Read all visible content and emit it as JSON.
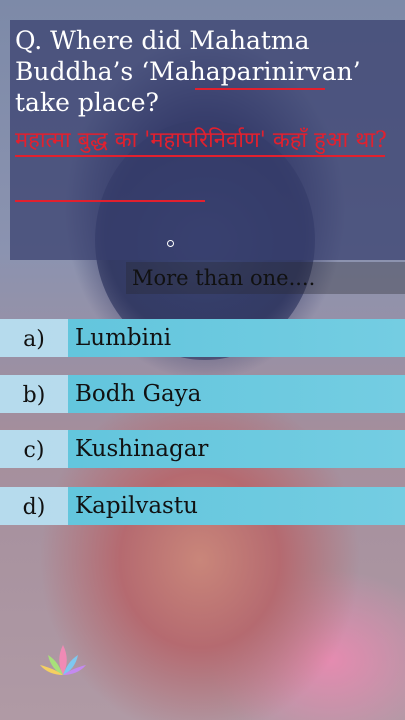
{
  "question": {
    "english": "Q. Where did Mahatma Buddha’s ‘Mahaparinirvan’ take place?",
    "hindi": "महात्मा बुद्ध का 'महापरिनिर्वाण' कहाँ हुआ था?"
  },
  "hint": "More than one....",
  "options": [
    {
      "letter": "a)",
      "text": "Lumbini"
    },
    {
      "letter": "b)",
      "text": "Bodh Gaya"
    },
    {
      "letter": "c)",
      "text": "Kushinagar"
    },
    {
      "letter": "d)",
      "text": "Kapilvastu"
    }
  ],
  "colors": {
    "question_bg": "#373e6e",
    "hindi_text": "#e2202e",
    "option_bar": "#5fc4dc",
    "option_letter_bg": "#bedcee"
  }
}
